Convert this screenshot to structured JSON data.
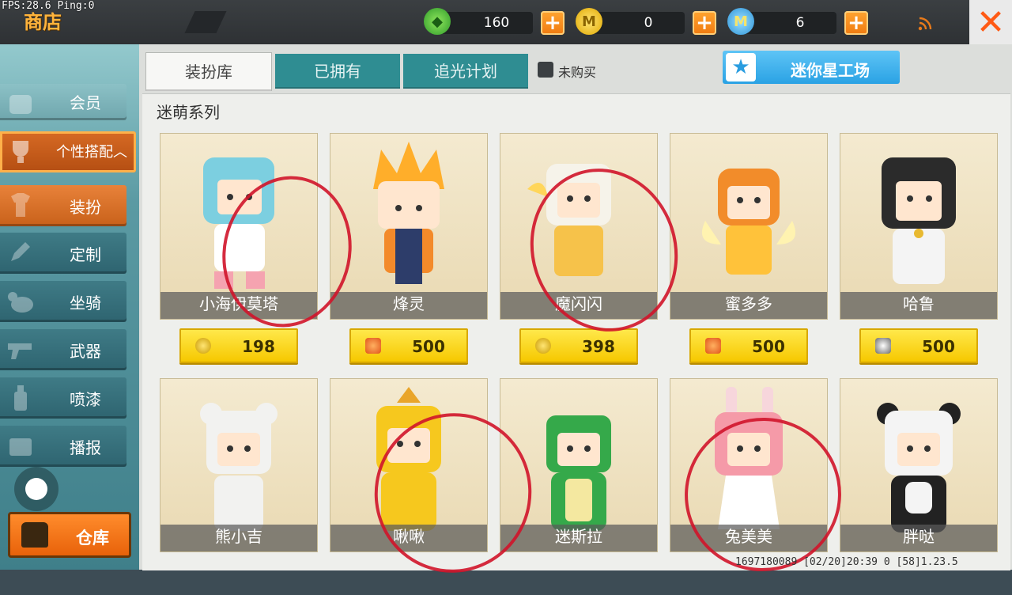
{
  "debug": "FPS:28.6  Ping:0",
  "header": {
    "title": "商店",
    "currencies": [
      {
        "icon": "green-gem-icon",
        "value": "160",
        "color": "#4fbf3a"
      },
      {
        "icon": "gold-coin-icon",
        "value": "0",
        "color": "#f2c21a"
      },
      {
        "icon": "blue-mini-coin-icon",
        "value": "6",
        "color": "#3aa8e8"
      }
    ],
    "plus": "+",
    "close": "✕"
  },
  "sidebar": {
    "member": "会员",
    "category": "个性搭配︿",
    "items": [
      "装扮",
      "定制",
      "坐骑",
      "武器",
      "喷漆",
      "播报"
    ],
    "warehouse": "仓库"
  },
  "tabs": [
    "装扮库",
    "已拥有",
    "追光计划"
  ],
  "filter_label": "未购买",
  "workshop": {
    "label": "迷你星工场",
    "icon": "★"
  },
  "series_title": "迷萌系列",
  "row1": [
    {
      "name": "小海伊莫塔",
      "price": "198",
      "currency": "gold-coin-icon",
      "color": "#7ccfe0"
    },
    {
      "name": "烽灵",
      "price": "500",
      "currency": "fox-token-icon",
      "color": "#ffae2a"
    },
    {
      "name": "魔闪闪",
      "price": "398",
      "currency": "gold-coin-icon",
      "color": "#f6f3ea"
    },
    {
      "name": "蜜多多",
      "price": "500",
      "currency": "fox-token-icon",
      "color": "#ffc23a"
    },
    {
      "name": "哈鲁",
      "price": "500",
      "currency": "dog-token-icon",
      "color": "#2b2b2b"
    }
  ],
  "row2": [
    {
      "name": "熊小吉",
      "color": "#f2f2f0"
    },
    {
      "name": "啾啾",
      "color": "#f6c81e"
    },
    {
      "name": "迷斯拉",
      "color": "#35a94a"
    },
    {
      "name": "兔美美",
      "color": "#f59aa8"
    },
    {
      "name": "胖哒",
      "color": "#f4f4f4"
    }
  ],
  "footer": "1697180089  [02/20]20:39 0  [58]1.23.5"
}
